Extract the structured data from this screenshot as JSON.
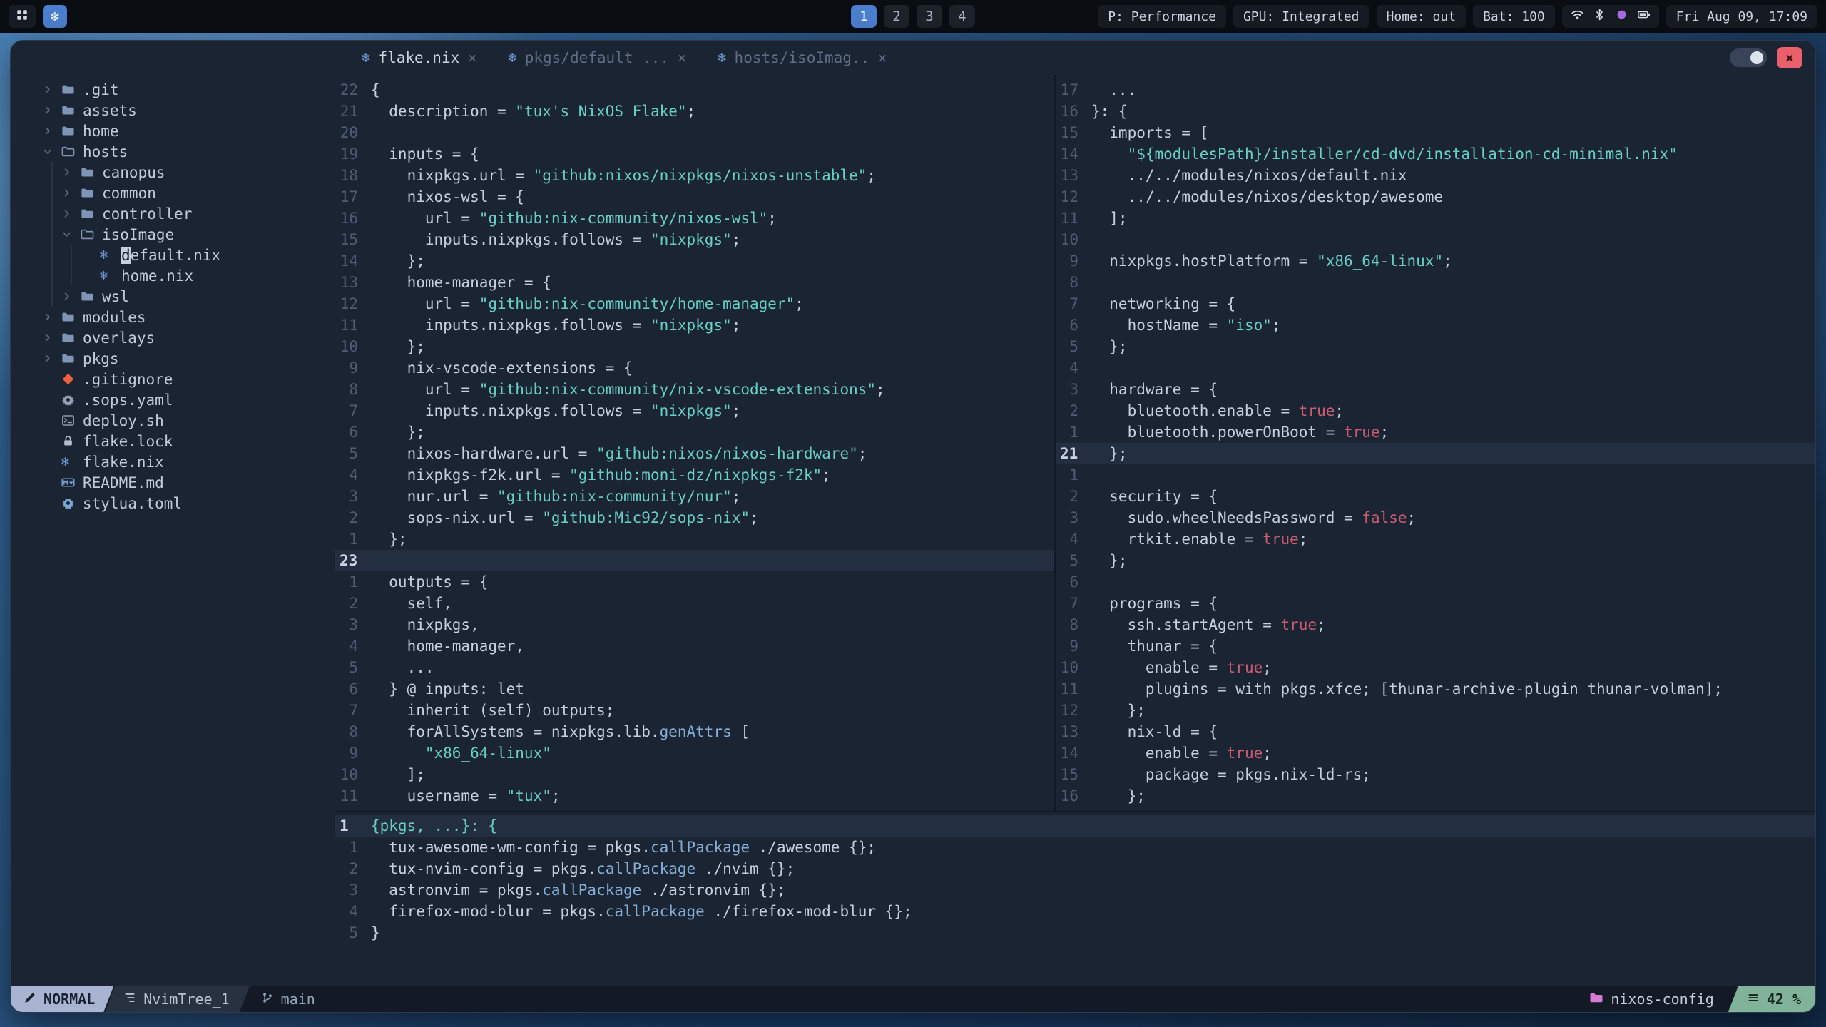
{
  "icons": {
    "nix": "❄",
    "close": "×"
  },
  "topbar": {
    "workspaces": [
      "1",
      "2",
      "3",
      "4"
    ],
    "active_workspace": "1",
    "pills": [
      "P: Performance",
      "GPU: Integrated",
      "Home: out",
      "Bat: 100"
    ],
    "tray_icons": [
      "wifi",
      "bluetooth",
      "indicator-dot",
      "battery"
    ],
    "clock": "Fri Aug 09, 17:09"
  },
  "window": {
    "tabs": [
      {
        "icon": "nix",
        "label": "flake.nix",
        "active": true
      },
      {
        "icon": "nix",
        "label": "pkgs/default ...",
        "active": false
      },
      {
        "icon": "nix",
        "label": "hosts/isoImag..",
        "active": false
      }
    ]
  },
  "tree": {
    "items": [
      {
        "indent": 0,
        "chev": "right",
        "icon": "folder",
        "label": ".git"
      },
      {
        "indent": 0,
        "chev": "right",
        "icon": "folder",
        "label": "assets"
      },
      {
        "indent": 0,
        "chev": "right",
        "icon": "folder",
        "label": "home"
      },
      {
        "indent": 0,
        "chev": "down",
        "icon": "folder-open",
        "label": "hosts"
      },
      {
        "indent": 1,
        "chev": "right",
        "icon": "folder",
        "label": "canopus"
      },
      {
        "indent": 1,
        "chev": "right",
        "icon": "folder",
        "label": "common"
      },
      {
        "indent": 1,
        "chev": "right",
        "icon": "folder",
        "label": "controller"
      },
      {
        "indent": 1,
        "chev": "down",
        "icon": "folder-open",
        "label": "isoImage"
      },
      {
        "indent": 2,
        "icon": "nix",
        "label": "default.nix",
        "cursor": true
      },
      {
        "indent": 2,
        "icon": "nix",
        "label": "home.nix"
      },
      {
        "indent": 1,
        "chev": "right",
        "icon": "folder",
        "label": "wsl"
      },
      {
        "indent": 0,
        "chev": "right",
        "icon": "folder",
        "label": "modules"
      },
      {
        "indent": 0,
        "chev": "right",
        "icon": "folder",
        "label": "overlays"
      },
      {
        "indent": 0,
        "chev": "right",
        "icon": "folder",
        "label": "pkgs"
      },
      {
        "indent": 0,
        "icon": "git",
        "label": ".gitignore"
      },
      {
        "indent": 0,
        "icon": "gear",
        "label": ".sops.yaml"
      },
      {
        "indent": 0,
        "icon": "shell",
        "label": "deploy.sh"
      },
      {
        "indent": 0,
        "icon": "lock",
        "label": "flake.lock"
      },
      {
        "indent": 0,
        "icon": "nix",
        "label": "flake.nix"
      },
      {
        "indent": 0,
        "icon": "markdown",
        "label": "README.md"
      },
      {
        "indent": 0,
        "icon": "gear-blue",
        "label": "stylua.toml"
      }
    ]
  },
  "editors": {
    "left": {
      "lines": [
        {
          "n": "22",
          "t": [
            [
              "{",
              "f"
            ]
          ]
        },
        {
          "n": "21",
          "t": [
            [
              "  description = ",
              "f"
            ],
            [
              "\"tux's NixOS Flake\"",
              "s"
            ],
            [
              ";",
              "f"
            ]
          ]
        },
        {
          "n": "20",
          "t": []
        },
        {
          "n": "19",
          "t": [
            [
              "  inputs = {",
              "f"
            ]
          ]
        },
        {
          "n": "18",
          "t": [
            [
              "    nixpkgs.url = ",
              "f"
            ],
            [
              "\"github:nixos/nixpkgs/nixos-unstable\"",
              "s"
            ],
            [
              ";",
              "f"
            ]
          ]
        },
        {
          "n": "17",
          "t": [
            [
              "    nixos-wsl = {",
              "f"
            ]
          ]
        },
        {
          "n": "16",
          "t": [
            [
              "      url = ",
              "f"
            ],
            [
              "\"github:nix-community/nixos-wsl\"",
              "s"
            ],
            [
              ";",
              "f"
            ]
          ]
        },
        {
          "n": "15",
          "t": [
            [
              "      inputs.nixpkgs.follows = ",
              "f"
            ],
            [
              "\"nixpkgs\"",
              "s"
            ],
            [
              ";",
              "f"
            ]
          ]
        },
        {
          "n": "14",
          "t": [
            [
              "    };",
              "f"
            ]
          ]
        },
        {
          "n": "13",
          "t": [
            [
              "    home-manager = {",
              "f"
            ]
          ]
        },
        {
          "n": "12",
          "t": [
            [
              "      url = ",
              "f"
            ],
            [
              "\"github:nix-community/home-manager\"",
              "s"
            ],
            [
              ";",
              "f"
            ]
          ]
        },
        {
          "n": "11",
          "t": [
            [
              "      inputs.nixpkgs.follows = ",
              "f"
            ],
            [
              "\"nixpkgs\"",
              "s"
            ],
            [
              ";",
              "f"
            ]
          ]
        },
        {
          "n": "10",
          "t": [
            [
              "    };",
              "f"
            ]
          ]
        },
        {
          "n": "9",
          "t": [
            [
              "    nix-vscode-extensions = {",
              "f"
            ]
          ]
        },
        {
          "n": "8",
          "t": [
            [
              "      url = ",
              "f"
            ],
            [
              "\"github:nix-community/nix-vscode-extensions\"",
              "s"
            ],
            [
              ";",
              "f"
            ]
          ]
        },
        {
          "n": "7",
          "t": [
            [
              "      inputs.nixpkgs.follows = ",
              "f"
            ],
            [
              "\"nixpkgs\"",
              "s"
            ],
            [
              ";",
              "f"
            ]
          ]
        },
        {
          "n": "6",
          "t": [
            [
              "    };",
              "f"
            ]
          ]
        },
        {
          "n": "5",
          "t": [
            [
              "    nixos-hardware.url = ",
              "f"
            ],
            [
              "\"github:nixos/nixos-hardware\"",
              "s"
            ],
            [
              ";",
              "f"
            ]
          ]
        },
        {
          "n": "4",
          "t": [
            [
              "    nixpkgs-f2k.url = ",
              "f"
            ],
            [
              "\"github:moni-dz/nixpkgs-f2k\"",
              "s"
            ],
            [
              ";",
              "f"
            ]
          ]
        },
        {
          "n": "3",
          "t": [
            [
              "    nur.url = ",
              "f"
            ],
            [
              "\"github:nix-community/nur\"",
              "s"
            ],
            [
              ";",
              "f"
            ]
          ]
        },
        {
          "n": "2",
          "t": [
            [
              "    sops-nix.url = ",
              "f"
            ],
            [
              "\"github:Mic92/sops-nix\"",
              "s"
            ],
            [
              ";",
              "f"
            ]
          ]
        },
        {
          "n": "1",
          "t": [
            [
              "  };",
              "f"
            ]
          ]
        },
        {
          "n": "23",
          "cur": true,
          "t": []
        },
        {
          "n": "1",
          "t": [
            [
              "  outputs = {",
              "f"
            ]
          ]
        },
        {
          "n": "2",
          "t": [
            [
              "    self,",
              "f"
            ]
          ]
        },
        {
          "n": "3",
          "t": [
            [
              "    nixpkgs,",
              "f"
            ]
          ]
        },
        {
          "n": "4",
          "t": [
            [
              "    home-manager,",
              "f"
            ]
          ]
        },
        {
          "n": "5",
          "t": [
            [
              "    ...",
              "f"
            ]
          ]
        },
        {
          "n": "6",
          "t": [
            [
              "  } @ inputs: let",
              "f"
            ]
          ]
        },
        {
          "n": "7",
          "t": [
            [
              "    inherit (self) outputs;",
              "f"
            ]
          ]
        },
        {
          "n": "8",
          "t": [
            [
              "    forAllSystems = nixpkgs.lib.",
              "f"
            ],
            [
              "genAttrs",
              "fn"
            ],
            [
              " [",
              "f"
            ]
          ]
        },
        {
          "n": "9",
          "t": [
            [
              "      ",
              "f"
            ],
            [
              "\"x86_64-linux\"",
              "s"
            ]
          ]
        },
        {
          "n": "10",
          "t": [
            [
              "    ];",
              "f"
            ]
          ]
        },
        {
          "n": "11",
          "t": [
            [
              "    username = ",
              "f"
            ],
            [
              "\"tux\"",
              "s"
            ],
            [
              ";",
              "f"
            ]
          ]
        }
      ]
    },
    "right": {
      "lines": [
        {
          "n": "17",
          "t": [
            [
              "  ...",
              "f"
            ]
          ]
        },
        {
          "n": "16",
          "t": [
            [
              "}: {",
              "f"
            ]
          ]
        },
        {
          "n": "15",
          "t": [
            [
              "  imports = [",
              "f"
            ]
          ]
        },
        {
          "n": "14",
          "t": [
            [
              "    ",
              "f"
            ],
            [
              "\"${modulesPath}/installer/cd-dvd/installation-cd-minimal.nix\"",
              "s"
            ]
          ]
        },
        {
          "n": "13",
          "t": [
            [
              "    ../../modules/nixos/default.nix",
              "f"
            ]
          ]
        },
        {
          "n": "12",
          "t": [
            [
              "    ../../modules/nixos/desktop/awesome",
              "f"
            ]
          ]
        },
        {
          "n": "11",
          "t": [
            [
              "  ];",
              "f"
            ]
          ]
        },
        {
          "n": "10",
          "t": []
        },
        {
          "n": "9",
          "t": [
            [
              "  nixpkgs.hostPlatform = ",
              "f"
            ],
            [
              "\"x86_64-linux\"",
              "s"
            ],
            [
              ";",
              "f"
            ]
          ]
        },
        {
          "n": "8",
          "t": []
        },
        {
          "n": "7",
          "t": [
            [
              "  networking = {",
              "f"
            ]
          ]
        },
        {
          "n": "6",
          "t": [
            [
              "    hostName = ",
              "f"
            ],
            [
              "\"iso\"",
              "s"
            ],
            [
              ";",
              "f"
            ]
          ]
        },
        {
          "n": "5",
          "t": [
            [
              "  };",
              "f"
            ]
          ]
        },
        {
          "n": "4",
          "t": []
        },
        {
          "n": "3",
          "t": [
            [
              "  hardware = {",
              "f"
            ]
          ]
        },
        {
          "n": "2",
          "t": [
            [
              "    bluetooth.enable = ",
              "f"
            ],
            [
              "true",
              "b"
            ],
            [
              ";",
              "f"
            ]
          ]
        },
        {
          "n": "1",
          "t": [
            [
              "    bluetooth.powerOnBoot = ",
              "f"
            ],
            [
              "true",
              "b"
            ],
            [
              ";",
              "f"
            ]
          ]
        },
        {
          "n": "21",
          "cur": true,
          "t": [
            [
              "  };",
              "f"
            ]
          ]
        },
        {
          "n": "1",
          "t": []
        },
        {
          "n": "2",
          "t": [
            [
              "  security = {",
              "f"
            ]
          ]
        },
        {
          "n": "3",
          "t": [
            [
              "    sudo.wheelNeedsPassword = ",
              "f"
            ],
            [
              "false",
              "b"
            ],
            [
              ";",
              "f"
            ]
          ]
        },
        {
          "n": "4",
          "t": [
            [
              "    rtkit.enable = ",
              "f"
            ],
            [
              "true",
              "b"
            ],
            [
              ";",
              "f"
            ]
          ]
        },
        {
          "n": "5",
          "t": [
            [
              "  };",
              "f"
            ]
          ]
        },
        {
          "n": "6",
          "t": []
        },
        {
          "n": "7",
          "t": [
            [
              "  programs = {",
              "f"
            ]
          ]
        },
        {
          "n": "8",
          "t": [
            [
              "    ssh.startAgent = ",
              "f"
            ],
            [
              "true",
              "b"
            ],
            [
              ";",
              "f"
            ]
          ]
        },
        {
          "n": "9",
          "t": [
            [
              "    thunar = {",
              "f"
            ]
          ]
        },
        {
          "n": "10",
          "t": [
            [
              "      enable = ",
              "f"
            ],
            [
              "true",
              "b"
            ],
            [
              ";",
              "f"
            ]
          ]
        },
        {
          "n": "11",
          "t": [
            [
              "      plugins = with pkgs.xfce; [thunar-archive-plugin thunar-volman];",
              "f"
            ]
          ]
        },
        {
          "n": "12",
          "t": [
            [
              "    };",
              "f"
            ]
          ]
        },
        {
          "n": "13",
          "t": [
            [
              "    nix-ld = {",
              "f"
            ]
          ]
        },
        {
          "n": "14",
          "t": [
            [
              "      enable = ",
              "f"
            ],
            [
              "true",
              "b"
            ],
            [
              ";",
              "f"
            ]
          ]
        },
        {
          "n": "15",
          "t": [
            [
              "      package = pkgs.nix-ld-rs;",
              "f"
            ]
          ]
        },
        {
          "n": "16",
          "t": [
            [
              "    };",
              "f"
            ]
          ]
        }
      ]
    },
    "bottom": {
      "lines": [
        {
          "n": "1",
          "cur": true,
          "t": [
            [
              "{pkgs, ...}: {",
              "s"
            ]
          ]
        },
        {
          "n": "1",
          "t": [
            [
              "  tux-awesome-wm-config = pkgs.",
              "f"
            ],
            [
              "callPackage",
              "fn"
            ],
            [
              " ./awesome {};",
              "f"
            ]
          ]
        },
        {
          "n": "2",
          "t": [
            [
              "  tux-nvim-config = pkgs.",
              "f"
            ],
            [
              "callPackage",
              "fn"
            ],
            [
              " ./nvim {};",
              "f"
            ]
          ]
        },
        {
          "n": "3",
          "t": [
            [
              "  astronvim = pkgs.",
              "f"
            ],
            [
              "callPackage",
              "fn"
            ],
            [
              " ./astronvim {};",
              "f"
            ]
          ]
        },
        {
          "n": "4",
          "t": [
            [
              "  firefox-mod-blur = pkgs.",
              "f"
            ],
            [
              "callPackage",
              "fn"
            ],
            [
              " ./firefox-mod-blur {};",
              "f"
            ]
          ]
        },
        {
          "n": "5",
          "t": [
            [
              "}",
              "f"
            ]
          ]
        }
      ]
    }
  },
  "statusline": {
    "mode": "NORMAL",
    "buffer": "NvimTree_1",
    "branch": "main",
    "project": "nixos-config",
    "scroll": "42 %"
  }
}
